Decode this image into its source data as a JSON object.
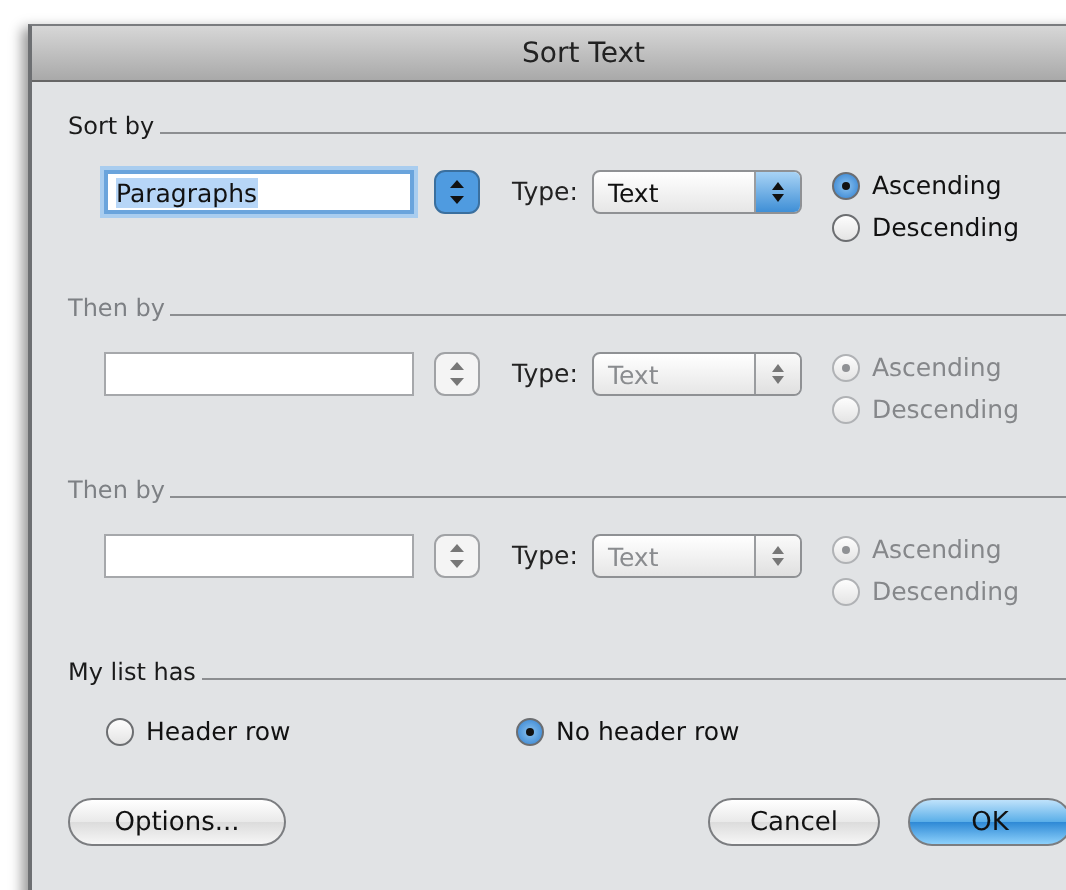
{
  "window": {
    "title": "Sort Text"
  },
  "sort_levels": [
    {
      "label": "Sort by",
      "disabled": false,
      "field": {
        "value": "Paragraphs",
        "focused": true
      },
      "type_label": "Type:",
      "type_value": "Text",
      "options": [
        {
          "label": "Ascending",
          "selected": true
        },
        {
          "label": "Descending",
          "selected": false
        }
      ]
    },
    {
      "label": "Then by",
      "disabled": true,
      "field": {
        "focused": false
      },
      "type_label": "Type:",
      "type_value": "Text",
      "options": [
        {
          "label": "Ascending",
          "selected": true
        },
        {
          "label": "Descending",
          "selected": false
        }
      ]
    },
    {
      "label": "Then by",
      "disabled": true,
      "field": {
        "focused": false
      },
      "type_label": "Type:",
      "type_value": "Text",
      "options": [
        {
          "label": "Ascending",
          "selected": true
        },
        {
          "label": "Descending",
          "selected": false
        }
      ]
    }
  ],
  "list_header": {
    "label": "My list has",
    "options": [
      {
        "label": "Header row",
        "selected": false
      },
      {
        "label": "No header row",
        "selected": true
      }
    ]
  },
  "buttons": [
    {
      "label": "Options...",
      "default": false
    },
    {
      "label": "Cancel",
      "default": false
    },
    {
      "label": "OK",
      "default": true
    }
  ]
}
